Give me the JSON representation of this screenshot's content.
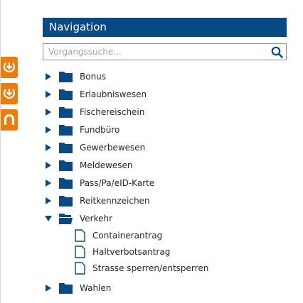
{
  "colors": {
    "accent": "#074a86",
    "side_tab": "#ef7b0b",
    "tree_text": "#1e2630"
  },
  "side_tabs": [
    {
      "icon": "download-arrow-icon"
    },
    {
      "icon": "download-arrow-icon"
    },
    {
      "icon": "magnet-icon"
    }
  ],
  "navigation": {
    "title": "Navigation",
    "search_placeholder": "Vorgangssuche...",
    "search_icon": "search-icon"
  },
  "tree": {
    "items": [
      {
        "label": "Bonus",
        "expanded": false
      },
      {
        "label": "Erlaubniswesen",
        "expanded": false
      },
      {
        "label": "Fischereischein",
        "expanded": false
      },
      {
        "label": "Fundbüro",
        "expanded": false
      },
      {
        "label": "Gewerbewesen",
        "expanded": false
      },
      {
        "label": "Meldewesen",
        "expanded": false
      },
      {
        "label": "Pass/Pa/eID-Karte",
        "expanded": false
      },
      {
        "label": "Reitkennzeichen",
        "expanded": false
      },
      {
        "label": "Verkehr",
        "expanded": true,
        "children": [
          {
            "label": "Containerantrag"
          },
          {
            "label": "Haltverbotsantrag"
          },
          {
            "label": "Strasse sperren/entsperren"
          }
        ]
      },
      {
        "label": "Wahlen",
        "expanded": false
      }
    ]
  }
}
